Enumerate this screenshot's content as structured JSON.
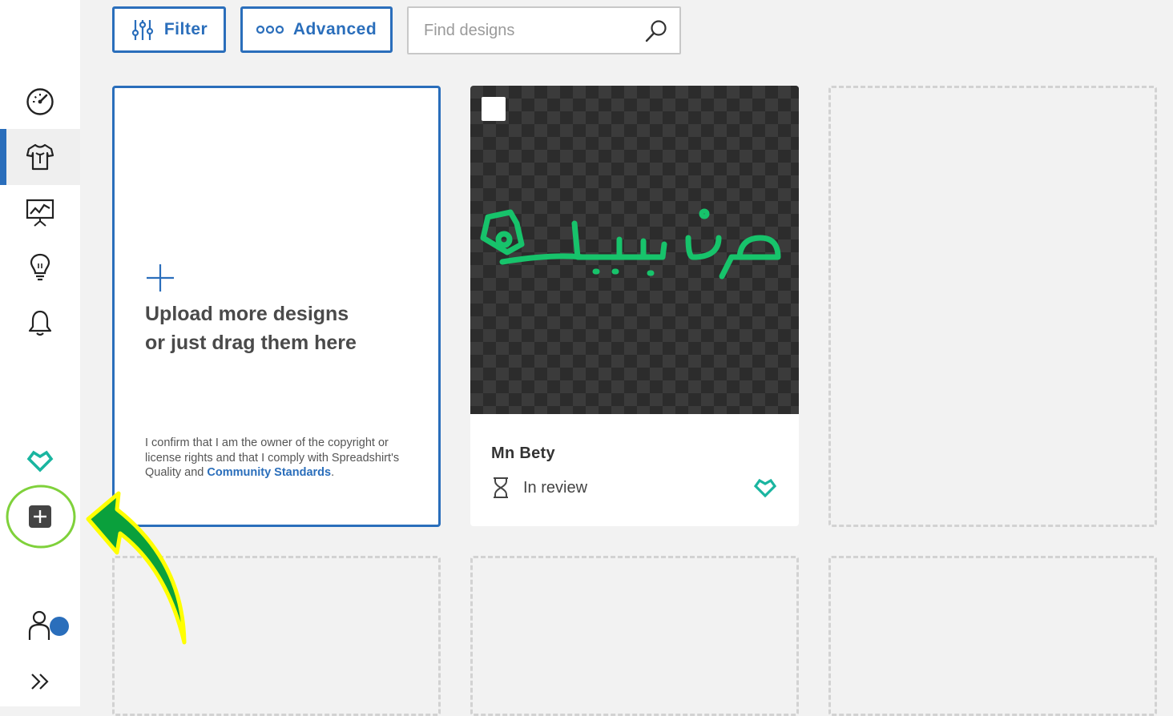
{
  "toolbar": {
    "filter_label": "Filter",
    "advanced_label": "Advanced",
    "search_placeholder": "Find designs"
  },
  "sidebar": {
    "items": [
      {
        "name": "dashboard",
        "icon": "speedometer-icon"
      },
      {
        "name": "designs",
        "icon": "tshirt-icon",
        "active": true
      },
      {
        "name": "statistics",
        "icon": "presentation-chart-icon"
      },
      {
        "name": "ideas",
        "icon": "lightbulb-icon"
      },
      {
        "name": "notifications",
        "icon": "bell-icon"
      },
      {
        "name": "favorite",
        "icon": "heart-outline-icon"
      },
      {
        "name": "add",
        "icon": "plus-square-icon"
      },
      {
        "name": "account",
        "icon": "user-icon"
      },
      {
        "name": "expand",
        "icon": "double-chevron-right-icon"
      }
    ]
  },
  "upload_card": {
    "title_line1": "Upload more designs",
    "title_line2": "or just drag them here",
    "legal_text": "I confirm that I am the owner of the copyright or license rights and that I comply with Spreadshirt's Quality and",
    "legal_link": "Community Standards",
    "legal_end": "."
  },
  "designs": [
    {
      "name": "Mn Bety",
      "status": "In review",
      "art_text": "من بيتي"
    }
  ],
  "colors": {
    "accent": "#2a6ebb",
    "heart": "#1ab5a0",
    "art_green": "#17c36b",
    "annotation_green": "#0aa03c",
    "annotation_yellow": "#ffff00"
  }
}
